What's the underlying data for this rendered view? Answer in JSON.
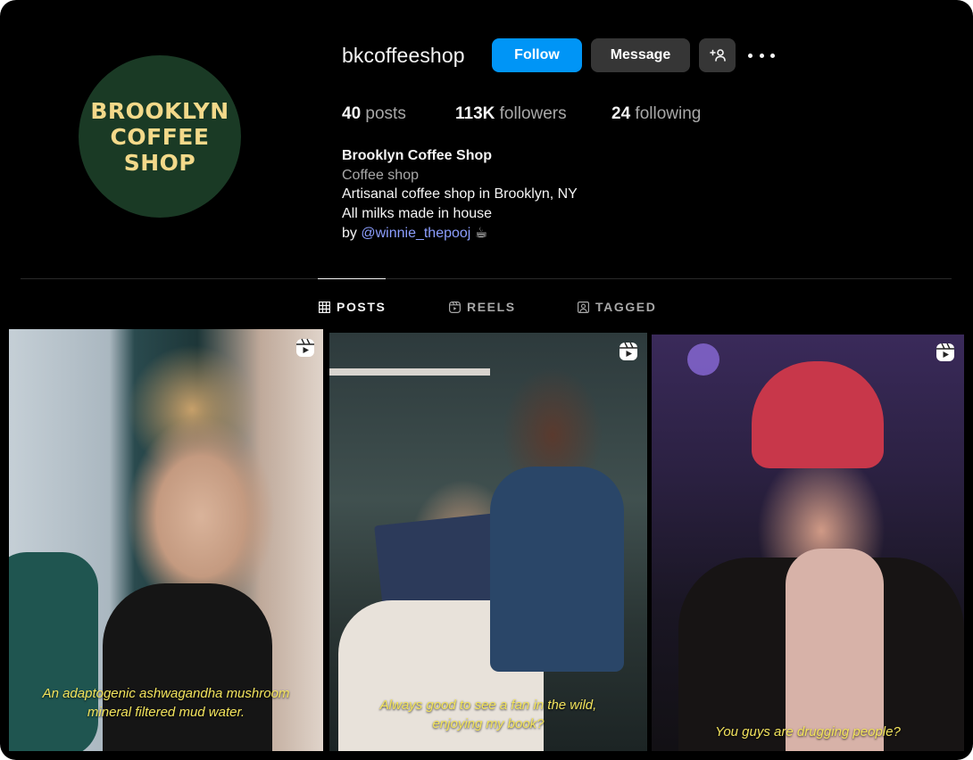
{
  "profile": {
    "username": "bkcoffeeshop",
    "avatar_lines": [
      "BROOKLYN",
      "COFFEE",
      "SHOP"
    ],
    "buttons": {
      "follow": "Follow",
      "message": "Message"
    },
    "stats": {
      "posts_count": "40",
      "posts_label": "posts",
      "followers_count": "113K",
      "followers_label": "followers",
      "following_count": "24",
      "following_label": "following"
    },
    "bio": {
      "name": "Brooklyn Coffee Shop",
      "category": "Coffee shop",
      "line1": "Artisanal coffee shop in Brooklyn, NY",
      "line2": "All milks made in house",
      "line3_prefix": "by",
      "mention": "@winnie_thepooj",
      "emoji": "☕"
    }
  },
  "tabs": [
    {
      "label": "POSTS",
      "icon": "grid-icon",
      "active": true
    },
    {
      "label": "REELS",
      "icon": "reels-icon",
      "active": false
    },
    {
      "label": "TAGGED",
      "icon": "tagged-icon",
      "active": false
    }
  ],
  "posts": [
    {
      "caption_line1": "An adaptogenic ashwagandha mushroom",
      "caption_line2": "mineral filtered mud water.",
      "icon": "reel-icon"
    },
    {
      "caption_line1": "Always good to see a fan in the wild,",
      "caption_line2": "enjoying my book?",
      "icon": "reel-icon"
    },
    {
      "caption_line1": "You guys are drugging people?",
      "icon": "reel-icon"
    }
  ],
  "colors": {
    "accent": "#0095f6",
    "background": "#000000",
    "secondary_button": "#363636",
    "caption": "#f2e35c",
    "mention": "#8c9eff"
  }
}
